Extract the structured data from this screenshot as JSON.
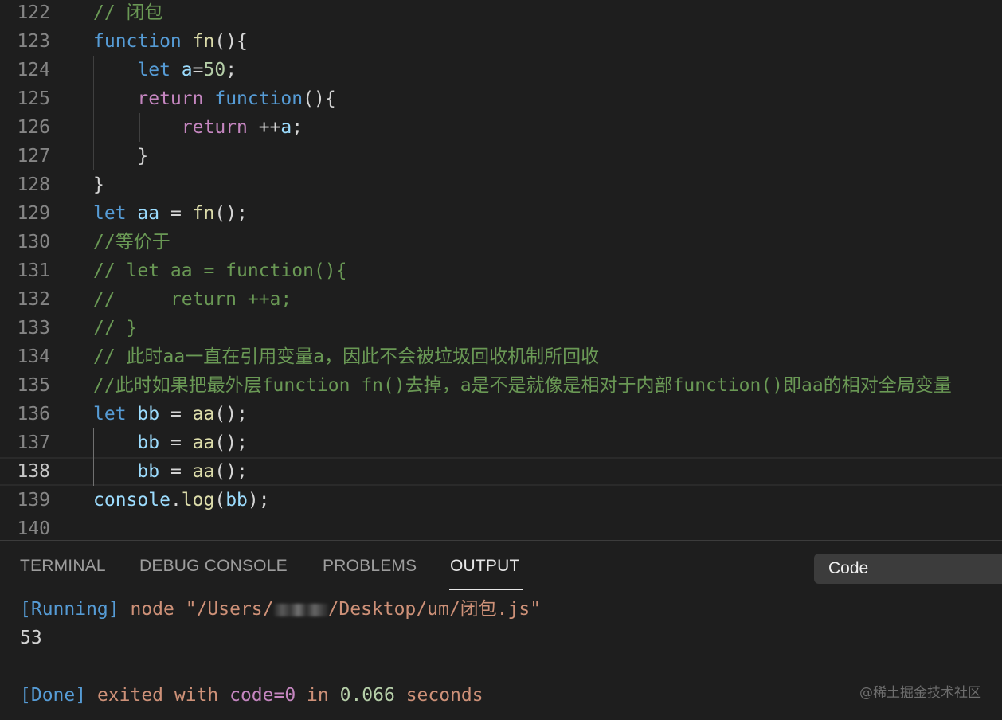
{
  "editor": {
    "current_line": 138,
    "lines": [
      {
        "n": "122",
        "tokens": [
          {
            "t": "// 闭包",
            "c": "cmt"
          }
        ]
      },
      {
        "n": "123",
        "tokens": [
          {
            "t": "function",
            "c": "kw"
          },
          {
            "t": " ",
            "c": "pl"
          },
          {
            "t": "fn",
            "c": "fnn"
          },
          {
            "t": "(){",
            "c": "pl"
          }
        ]
      },
      {
        "n": "124",
        "tokens": [
          {
            "t": "    ",
            "c": "pl"
          },
          {
            "t": "let",
            "c": "kw"
          },
          {
            "t": " ",
            "c": "pl"
          },
          {
            "t": "a",
            "c": "var"
          },
          {
            "t": "=",
            "c": "pl"
          },
          {
            "t": "50",
            "c": "num"
          },
          {
            "t": ";",
            "c": "pl"
          }
        ]
      },
      {
        "n": "125",
        "tokens": [
          {
            "t": "    ",
            "c": "pl"
          },
          {
            "t": "return",
            "c": "ctl"
          },
          {
            "t": " ",
            "c": "pl"
          },
          {
            "t": "function",
            "c": "kw"
          },
          {
            "t": "(){",
            "c": "pl"
          }
        ]
      },
      {
        "n": "126",
        "tokens": [
          {
            "t": "        ",
            "c": "pl"
          },
          {
            "t": "return",
            "c": "ctl"
          },
          {
            "t": " ++",
            "c": "pl"
          },
          {
            "t": "a",
            "c": "var"
          },
          {
            "t": ";",
            "c": "pl"
          }
        ]
      },
      {
        "n": "127",
        "tokens": [
          {
            "t": "    }",
            "c": "pl"
          }
        ]
      },
      {
        "n": "128",
        "tokens": [
          {
            "t": "}",
            "c": "pl"
          }
        ]
      },
      {
        "n": "129",
        "tokens": [
          {
            "t": "let",
            "c": "kw"
          },
          {
            "t": " ",
            "c": "pl"
          },
          {
            "t": "aa",
            "c": "var"
          },
          {
            "t": " = ",
            "c": "pl"
          },
          {
            "t": "fn",
            "c": "fnn"
          },
          {
            "t": "();",
            "c": "pl"
          }
        ]
      },
      {
        "n": "130",
        "tokens": [
          {
            "t": "//等价于",
            "c": "cmt"
          }
        ]
      },
      {
        "n": "131",
        "tokens": [
          {
            "t": "// let aa = function(){",
            "c": "cmt"
          }
        ]
      },
      {
        "n": "132",
        "tokens": [
          {
            "t": "//     return ++a;",
            "c": "cmt"
          }
        ]
      },
      {
        "n": "133",
        "tokens": [
          {
            "t": "// }",
            "c": "cmt"
          }
        ]
      },
      {
        "n": "134",
        "tokens": [
          {
            "t": "// 此时aa一直在引用变量a，因此不会被垃圾回收机制所回收",
            "c": "cmt"
          }
        ]
      },
      {
        "n": "135",
        "tokens": [
          {
            "t": "//此时如果把最外层function fn()去掉，a是不是就像是相对于内部function()即aa的相对全局变量",
            "c": "cmt"
          }
        ]
      },
      {
        "n": "136",
        "tokens": [
          {
            "t": "let",
            "c": "kw"
          },
          {
            "t": " ",
            "c": "pl"
          },
          {
            "t": "bb",
            "c": "var"
          },
          {
            "t": " = ",
            "c": "pl"
          },
          {
            "t": "aa",
            "c": "fnn"
          },
          {
            "t": "();",
            "c": "pl"
          }
        ]
      },
      {
        "n": "137",
        "tokens": [
          {
            "t": "    ",
            "c": "pl"
          },
          {
            "t": "bb",
            "c": "var"
          },
          {
            "t": " = ",
            "c": "pl"
          },
          {
            "t": "aa",
            "c": "fnn"
          },
          {
            "t": "();",
            "c": "pl"
          }
        ]
      },
      {
        "n": "138",
        "tokens": [
          {
            "t": "    ",
            "c": "pl"
          },
          {
            "t": "bb",
            "c": "var"
          },
          {
            "t": " = ",
            "c": "pl"
          },
          {
            "t": "aa",
            "c": "fnn"
          },
          {
            "t": "();",
            "c": "pl"
          }
        ]
      },
      {
        "n": "139",
        "tokens": [
          {
            "t": "console",
            "c": "var"
          },
          {
            "t": ".",
            "c": "pl"
          },
          {
            "t": "log",
            "c": "fnn"
          },
          {
            "t": "(",
            "c": "pl"
          },
          {
            "t": "bb",
            "c": "var"
          },
          {
            "t": ");",
            "c": "pl"
          }
        ]
      },
      {
        "n": "140",
        "tokens": []
      }
    ]
  },
  "panel": {
    "tabs": {
      "terminal": "TERMINAL",
      "debug_console": "DEBUG CONSOLE",
      "problems": "PROBLEMS",
      "output": "OUTPUT"
    },
    "active_tab": "OUTPUT",
    "channel": "Code",
    "output": {
      "running_tag": "[Running]",
      "command_prefix": " node \"/Users/",
      "command_suffix": "/Desktop/um/闭包.js\"",
      "result": "53",
      "done_tag": "[Done]",
      "exited_text": " exited with ",
      "code_text": "code=0",
      "in_text": " in ",
      "duration": "0.066",
      "seconds_text": " seconds"
    }
  },
  "watermark": "@稀土掘金技术社区",
  "colors": {
    "background": "#1e1e1e",
    "keyword": "#569cd6",
    "control": "#c586c0",
    "function": "#dcdcaa",
    "variable": "#9cdcfe",
    "number": "#b5cea8",
    "comment": "#6a9955",
    "string": "#ce9178"
  }
}
